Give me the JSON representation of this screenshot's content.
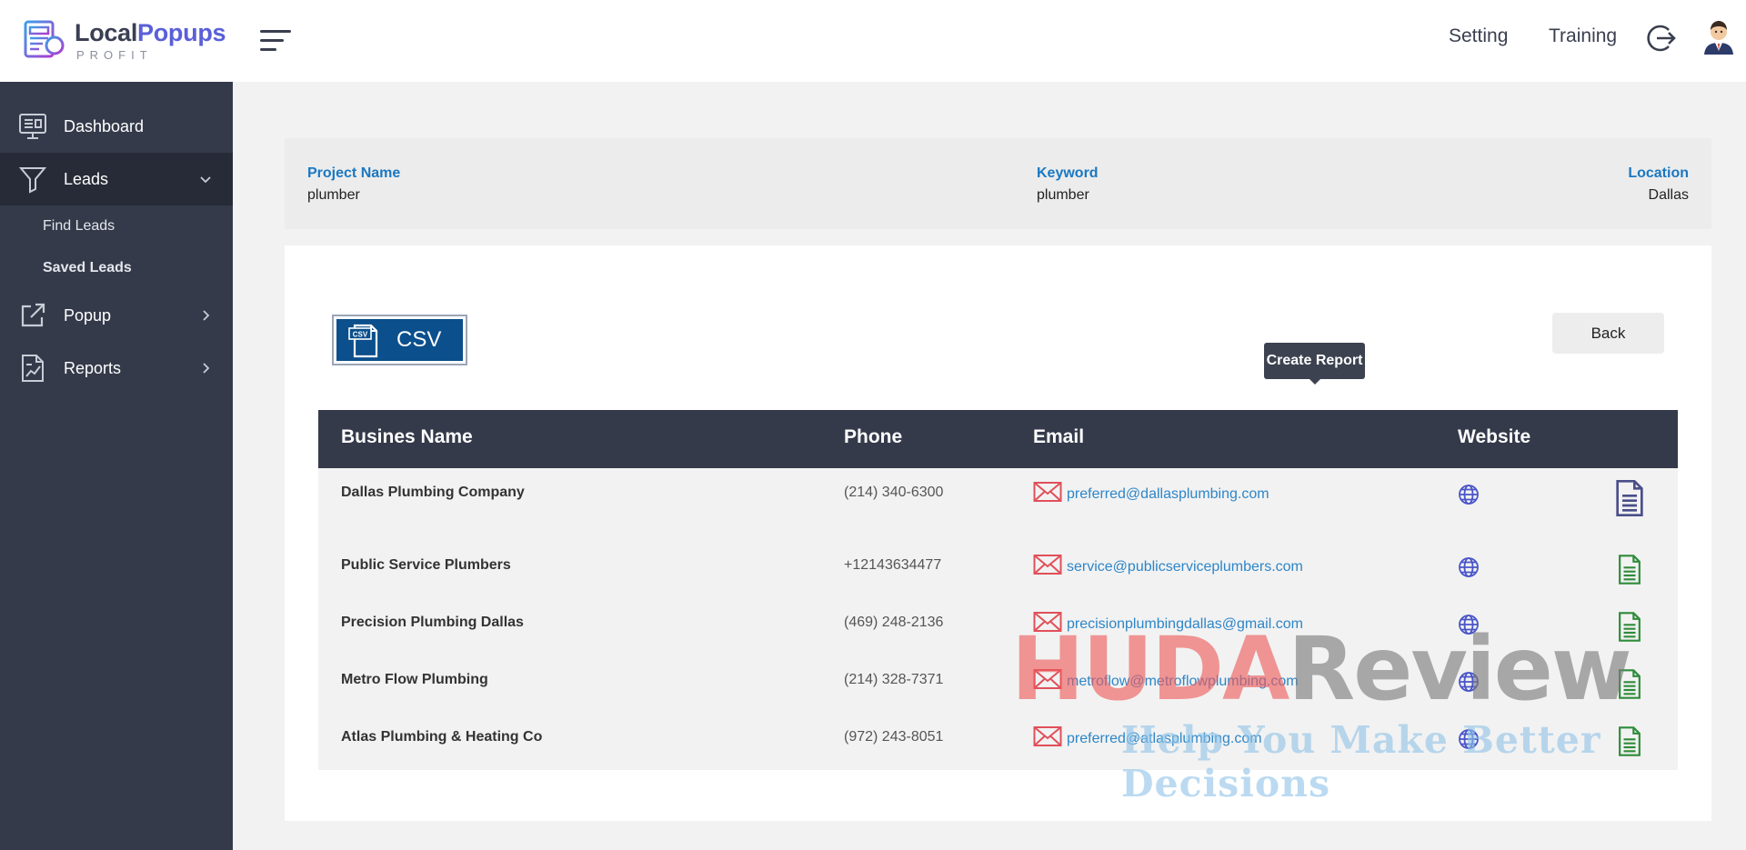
{
  "brand": {
    "name_part1": "Local",
    "name_part2": "Popups",
    "sub": "PROFIT"
  },
  "sidebar": {
    "items": [
      {
        "label": "Dashboard",
        "icon": "monitor-icon"
      },
      {
        "label": "Leads",
        "icon": "filter-icon",
        "expanded": true,
        "children": [
          "Find Leads",
          "Saved Leads"
        ]
      },
      {
        "label": "Popup",
        "icon": "external-link-icon"
      },
      {
        "label": "Reports",
        "icon": "report-chart-icon"
      }
    ]
  },
  "topbar": {
    "setting": "Setting",
    "training": "Training"
  },
  "project": {
    "name_label": "Project Name",
    "name_value": "plumber",
    "keyword_label": "Keyword",
    "keyword_value": "plumber",
    "location_label": "Location",
    "location_value": "Dallas"
  },
  "actions": {
    "csv_label": "CSV",
    "csv_badge": "CSV",
    "back_label": "Back"
  },
  "table": {
    "headers": {
      "name": "Busines Name",
      "phone": "Phone",
      "email": "Email",
      "website": "Website"
    },
    "rows": [
      {
        "name": "Dallas Plumbing Company",
        "phone": "(214) 340-6300",
        "email": "preferred@dallasplumbing.com"
      },
      {
        "name": "Public Service Plumbers",
        "phone": "+12143634477",
        "email": "service@publicserviceplumbers.com"
      },
      {
        "name": "Precision Plumbing Dallas",
        "phone": "(469) 248-2136",
        "email": "precisionplumbingdallas@gmail.com"
      },
      {
        "name": "Metro Flow Plumbing",
        "phone": "(214) 328-7371",
        "email": "metroflow@metroflowplumbing.com"
      },
      {
        "name": "Atlas Plumbing & Heating Co",
        "phone": "(972) 243-8051",
        "email": "preferred@atlasplumbing.com"
      }
    ]
  },
  "tooltip": {
    "text": "Create Report"
  },
  "watermark": {
    "part1": "HUDA",
    "part2": "Review",
    "tagline": "Help You Make Better Decisions"
  },
  "colors": {
    "sidebar_bg": "#343a4a",
    "sidebar_active": "#262b37",
    "link_blue": "#1a78c2",
    "email_icon": "#e0505a",
    "globe_icon": "#4a55c8",
    "report_green": "#2e8b3a",
    "report_purple": "#4a4f8a"
  }
}
